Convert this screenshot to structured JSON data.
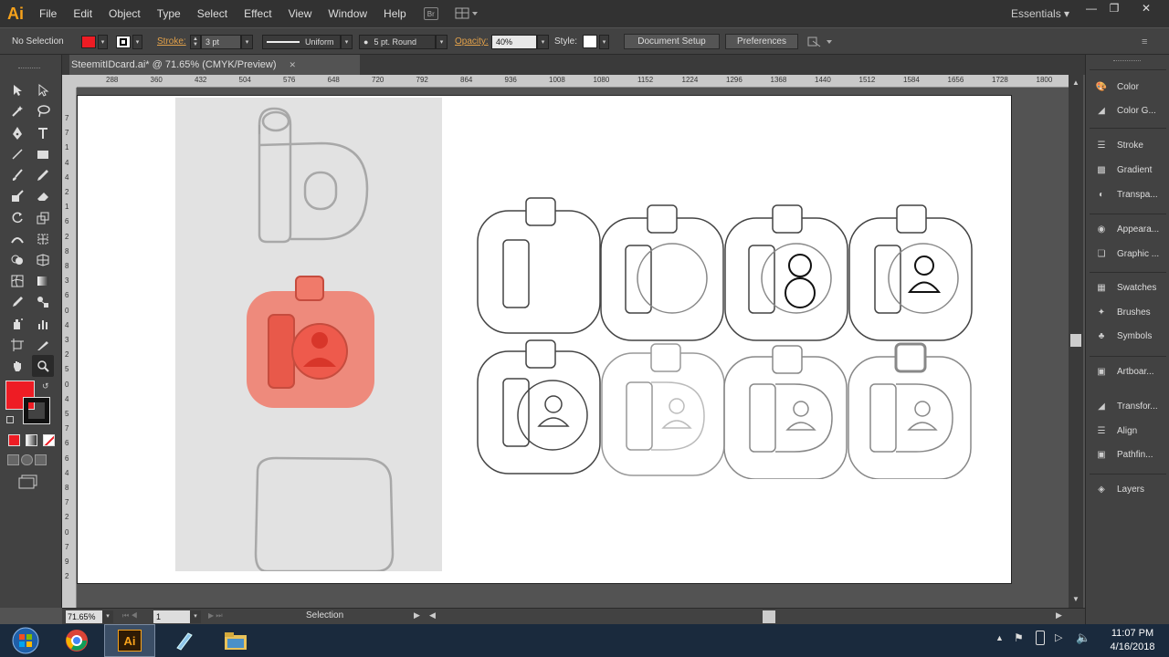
{
  "app": {
    "logo": "Ai",
    "workspace": "Essentials"
  },
  "menu": [
    "File",
    "Edit",
    "Object",
    "Type",
    "Select",
    "Effect",
    "View",
    "Window",
    "Help"
  ],
  "bridge_label": "Br",
  "control": {
    "selection": "No Selection",
    "stroke_label": "Stroke:",
    "stroke_weight": "3 pt",
    "profile": "Uniform",
    "brush": "5 pt. Round",
    "opacity_label": "Opacity:",
    "opacity": "40%",
    "style_label": "Style:",
    "document_setup": "Document Setup",
    "preferences": "Preferences",
    "fill_color": "#ee1c24"
  },
  "document": {
    "tab": "SteemitIDcard.ai* @ 71.65% (CMYK/Preview)",
    "close": "✕"
  },
  "ruler": {
    "h": [
      "288",
      "360",
      "432",
      "504",
      "576",
      "648",
      "720",
      "792",
      "864",
      "936",
      "1008",
      "1080",
      "1152",
      "1224",
      "1296",
      "1368",
      "1440",
      "1512",
      "1584",
      "1656",
      "1728",
      "1800"
    ],
    "v": [
      "7",
      "7",
      "1",
      "4",
      "4",
      "2",
      "1",
      "6",
      "2",
      "8",
      "8",
      "3",
      "6",
      "0",
      "4",
      "3",
      "2",
      "5",
      "0",
      "4",
      "5",
      "7",
      "6",
      "6",
      "4",
      "8",
      "7",
      "2",
      "0",
      "7",
      "9",
      "2"
    ]
  },
  "status": {
    "zoom": "71.65%",
    "page": "1",
    "mode": "Selection"
  },
  "panels": [
    {
      "label": "Color",
      "icon": "color-icon"
    },
    {
      "label": "Color G...",
      "icon": "color-guide-icon"
    },
    {
      "label": "Stroke",
      "icon": "stroke-icon"
    },
    {
      "label": "Gradient",
      "icon": "gradient-icon"
    },
    {
      "label": "Transpa...",
      "icon": "transparency-icon"
    },
    {
      "label": "Appeara...",
      "icon": "appearance-icon"
    },
    {
      "label": "Graphic ...",
      "icon": "graphic-styles-icon"
    },
    {
      "label": "Swatches",
      "icon": "swatches-icon"
    },
    {
      "label": "Brushes",
      "icon": "brushes-icon"
    },
    {
      "label": "Symbols",
      "icon": "symbols-icon"
    },
    {
      "label": "Artboar...",
      "icon": "artboards-icon"
    },
    {
      "label": "Transfor...",
      "icon": "transform-icon"
    },
    {
      "label": "Align",
      "icon": "align-icon"
    },
    {
      "label": "Pathfin...",
      "icon": "pathfinder-icon"
    },
    {
      "label": "Layers",
      "icon": "layers-icon"
    }
  ],
  "taskbar": {
    "time": "11:07 PM",
    "date": "4/16/2018",
    "ai_label": "Ai"
  },
  "colors": {
    "fill": "#ee1c24",
    "accent": "#f7a21b"
  }
}
